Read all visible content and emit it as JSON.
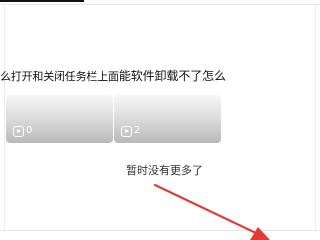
{
  "video_item": {
    "title_part_a": "么打开和关闭任务栏上面",
    "title_part_b": "能软件卸载不了怎么",
    "cards": [
      {
        "play_count": "0"
      },
      {
        "play_count": "2"
      }
    ]
  },
  "feed_footer": {
    "no_more_text": "暂时没有更多了"
  },
  "colors": {
    "annotation_arrow": "#e53935"
  },
  "icons": {
    "play": "play-icon"
  }
}
